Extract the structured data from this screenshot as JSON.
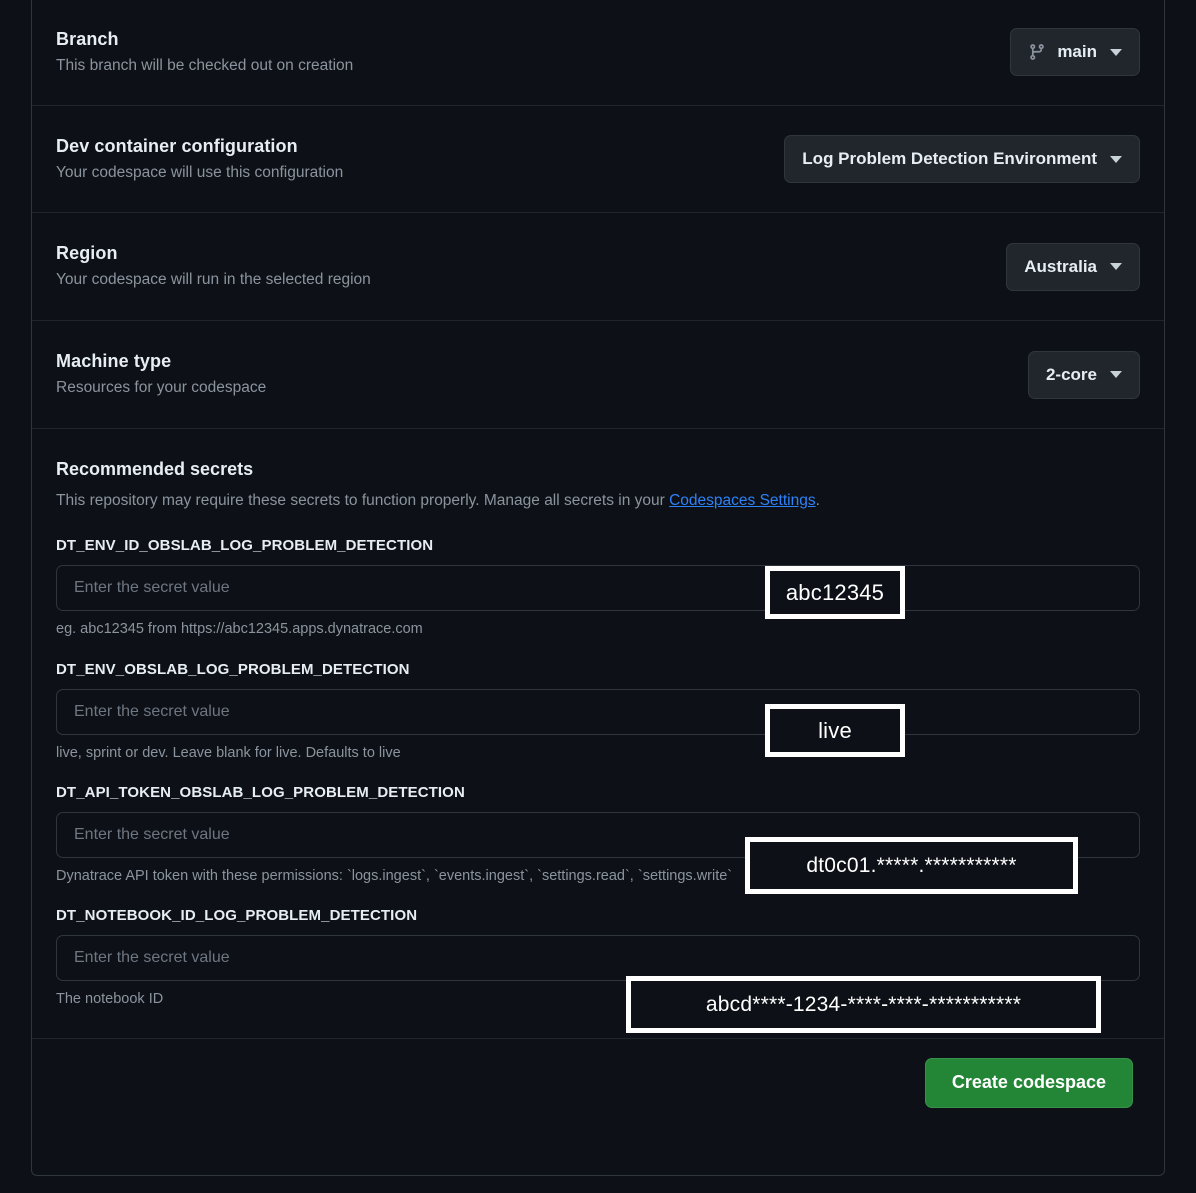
{
  "rows": [
    {
      "title": "Branch",
      "subtitle": "This branch will be checked out on creation",
      "control_label": "main",
      "icon": "git-branch-icon"
    },
    {
      "title": "Dev container configuration",
      "subtitle": "Your codespace will use this configuration",
      "control_label": "Log Problem Detection Environment"
    },
    {
      "title": "Region",
      "subtitle": "Your codespace will run in the selected region",
      "control_label": "Australia"
    },
    {
      "title": "Machine type",
      "subtitle": "Resources for your codespace",
      "control_label": "2-core"
    }
  ],
  "secrets": {
    "title": "Recommended secrets",
    "description_before_link": "This repository may require these secrets to function properly. Manage all secrets in your ",
    "link_label": "Codespaces Settings",
    "description_after_link": ".",
    "placeholder": "Enter the secret value",
    "fields": [
      {
        "name": "DT_ENV_ID_OBSLAB_LOG_PROBLEM_DETECTION",
        "value": "",
        "help": "eg. abc12345 from https://abc12345.apps.dynatrace.com"
      },
      {
        "name": "DT_ENV_OBSLAB_LOG_PROBLEM_DETECTION",
        "value": "",
        "help": "live, sprint or dev. Leave blank for live. Defaults to live"
      },
      {
        "name": "DT_API_TOKEN_OBSLAB_LOG_PROBLEM_DETECTION",
        "value": "",
        "help": "Dynatrace API token with these permissions: `logs.ingest`, `events.ingest`, `settings.read`, `settings.write`"
      },
      {
        "name": "DT_NOTEBOOK_ID_LOG_PROBLEM_DETECTION",
        "value": "",
        "help": "The notebook ID"
      }
    ]
  },
  "annotations": [
    {
      "id": "annot-env-id",
      "text": "abc12345"
    },
    {
      "id": "annot-env",
      "text": "live"
    },
    {
      "id": "annot-token",
      "text": "dt0c01.*****.***********"
    },
    {
      "id": "annot-notebook",
      "text": "abcd****-1234-****-****-***********"
    }
  ],
  "footer": {
    "create_label": "Create codespace"
  },
  "colors": {
    "background": "#0d1117",
    "border": "#30363d",
    "divider": "#21262d",
    "text_primary": "#e6edf3",
    "text_muted": "#8b949e",
    "link": "#2f81f7",
    "button_primary": "#238636",
    "annotation_border": "#ffffff"
  }
}
